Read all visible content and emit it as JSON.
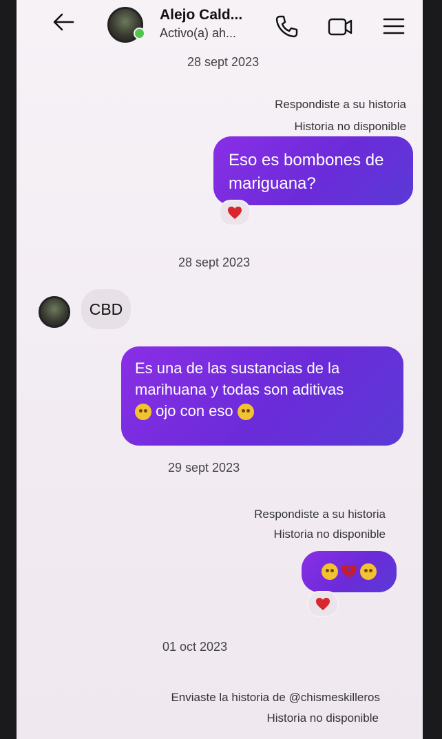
{
  "header": {
    "contact_name": "Alejo Cald...",
    "status": "Activo(a) ah..."
  },
  "colors": {
    "outgoing_bubble": "#7a2bdc",
    "incoming_bubble": "#e7e1e7",
    "online": "#4cc74a"
  },
  "messages": {
    "date1": "28 sept 2023",
    "reply1_line1": "Respondiste a su historia",
    "reply1_line2": "Historia no disponible",
    "msg1": "Eso es bombones de mariguana?",
    "date2": "28 sept 2023",
    "msg2": "CBD",
    "msg3_text": "Es una de las sustancias de la marihuana y todas son aditivas",
    "msg3_end": "ojo con eso",
    "date3": "29 sept 2023",
    "reply2_line1": "Respondiste a su historia",
    "reply2_line2": "Historia no disponible",
    "date4": "01 oct 2023",
    "share_line1": "Enviaste la historia de @chismeskilleros",
    "share_line2": "Historia no disponible"
  }
}
